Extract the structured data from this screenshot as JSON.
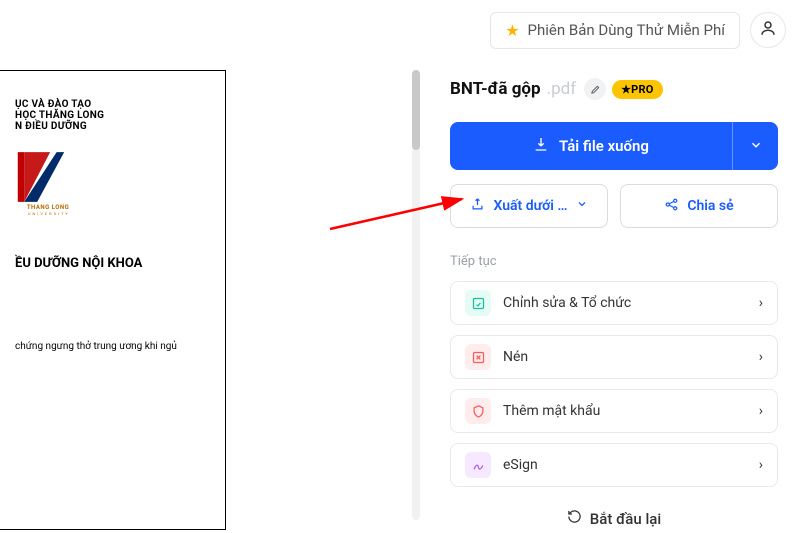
{
  "topbar": {
    "trial_label": "Phiên Bản Dùng Thử Miễn Phí"
  },
  "file": {
    "name": "BNT-đã gộp",
    "ext": ".pdf",
    "pro_badge": "★PRO"
  },
  "buttons": {
    "download": "Tải file xuống",
    "export": "Xuất dưới … ",
    "share": "Chia sẻ",
    "restart": "Bắt đầu lại"
  },
  "section": {
    "continue": "Tiếp tục"
  },
  "actions": {
    "edit": "Chỉnh sửa & Tổ chức",
    "compress": "Nén",
    "password": "Thêm mật khẩu",
    "esign": "eSign"
  },
  "doc_preview": {
    "line1": "ỤC VÀ ĐÀO TẠO",
    "line2": "HỌC THĂNG LONG",
    "line3": "N ĐIỀU DƯỠNG",
    "logo_text": "THANG LONG",
    "logo_sub": "U N I V E R S I T Y",
    "heading": "ỀU DƯỠNG NỘI KHOA",
    "paragraph": "chứng ngưng thở trung ương khi ngủ"
  }
}
